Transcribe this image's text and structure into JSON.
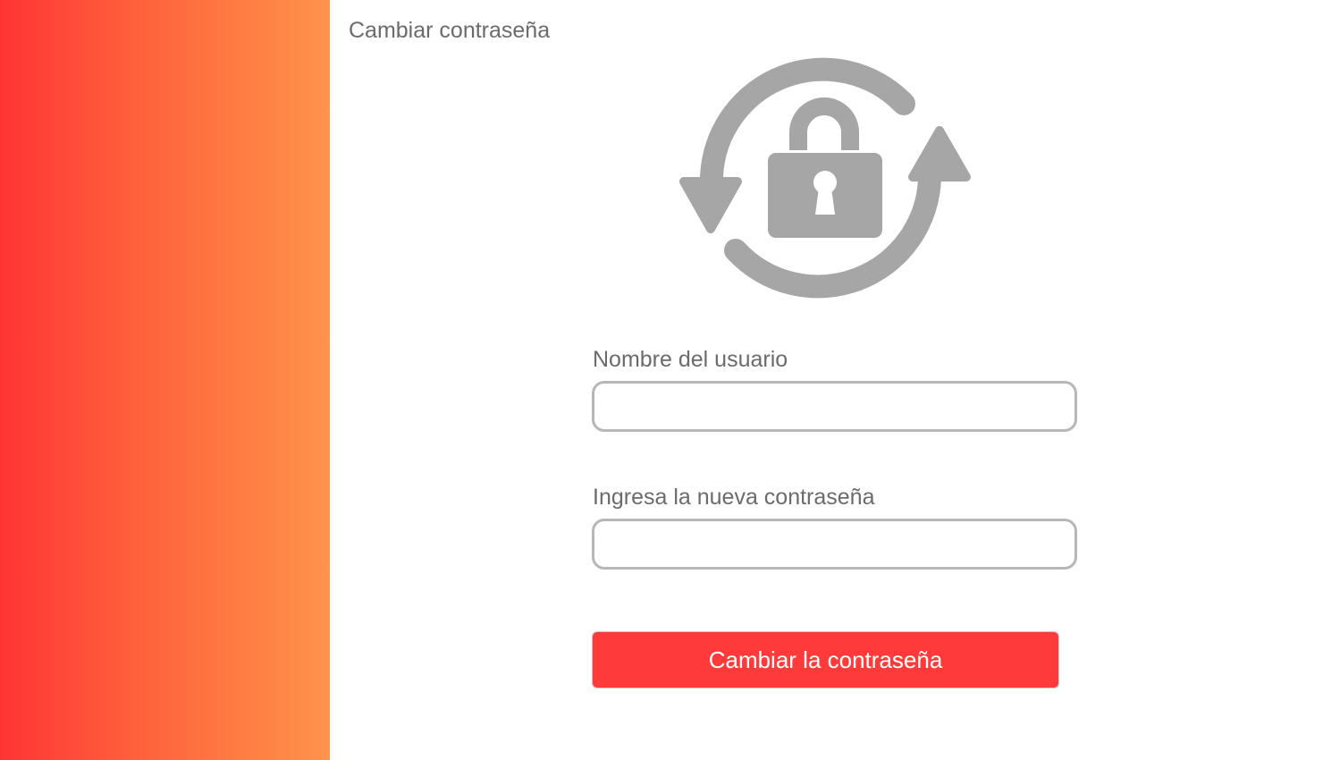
{
  "page": {
    "title": "Cambiar contraseña"
  },
  "form": {
    "username_label": "Nombre del usuario",
    "username_value": "",
    "password_label": "Ingresa la nueva contraseña",
    "password_value": "",
    "submit_label": "Cambiar la contraseña"
  },
  "icons": {
    "hero": "lock-refresh-icon"
  },
  "colors": {
    "sidebar_gradient_start": "#ff3434",
    "sidebar_gradient_end": "#ff934c",
    "accent": "#ff3a3a",
    "icon_gray": "#a6a6a6",
    "text_gray": "#6b6b6b",
    "input_border": "#b7b7b7"
  }
}
